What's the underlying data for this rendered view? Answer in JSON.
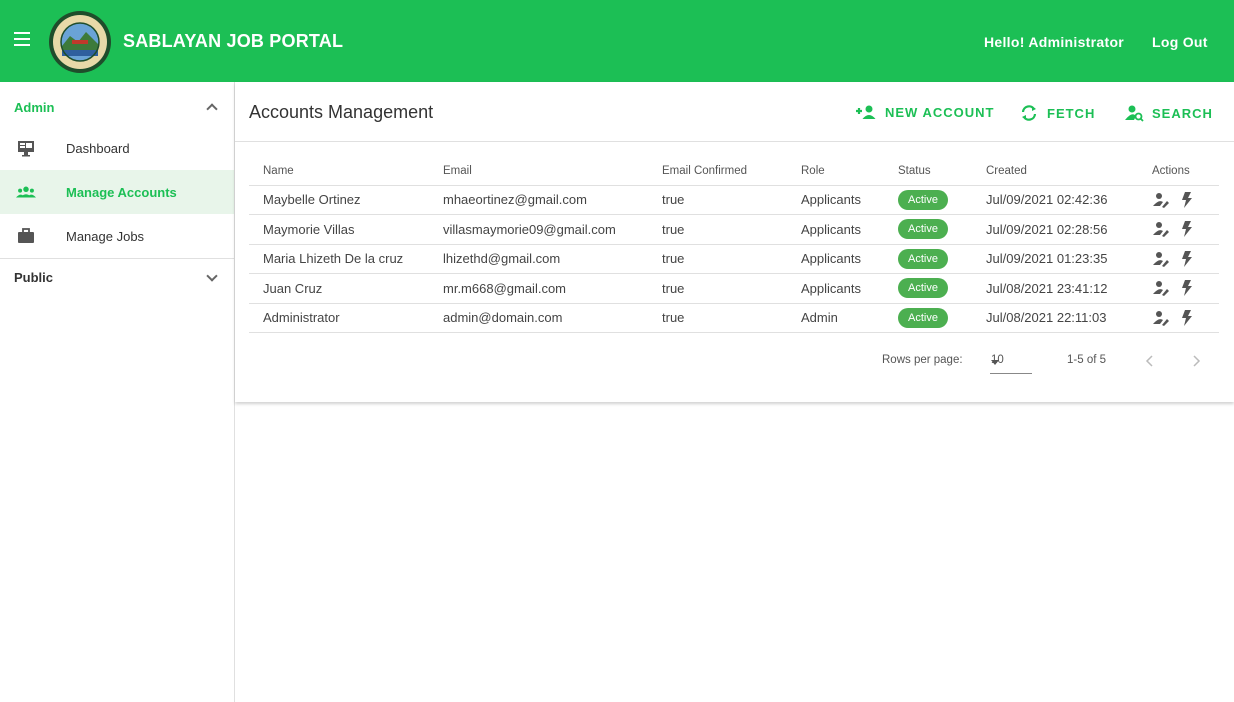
{
  "app": {
    "title": "SABLAYAN JOB PORTAL",
    "greeting": "Hello! Administrator",
    "logout_label": "Log Out"
  },
  "colors": {
    "primary": "#1cbf55",
    "active_badge": "#4caf50",
    "active_nav_bg": "#e8f5ea"
  },
  "sidebar": {
    "groups": [
      {
        "label": "Admin",
        "expanded": true,
        "items": [
          {
            "label": "Dashboard",
            "icon": "monitor-icon"
          },
          {
            "label": "Manage Accounts",
            "icon": "people-icon",
            "active": true
          },
          {
            "label": "Manage Jobs",
            "icon": "briefcase-icon"
          }
        ]
      },
      {
        "label": "Public",
        "expanded": false
      }
    ]
  },
  "main": {
    "title": "Accounts Management",
    "toolbar": {
      "new_account": "NEW ACCOUNT",
      "fetch": "FETCH",
      "search": "SEARCH"
    },
    "table": {
      "columns": [
        "Name",
        "Email",
        "Email Confirmed",
        "Role",
        "Status",
        "Created",
        "Actions"
      ],
      "rows": [
        [
          "Maybelle Ortinez",
          "mhaeortinez@gmail.com",
          "true",
          "Applicants",
          "Active",
          "Jul/09/2021 02:42:36"
        ],
        [
          "Maymorie Villas",
          "villasmaymorie09@gmail.com",
          "true",
          "Applicants",
          "Active",
          "Jul/09/2021 02:28:56"
        ],
        [
          "Maria Lhizeth De la cruz",
          "lhizethd@gmail.com",
          "true",
          "Applicants",
          "Active",
          "Jul/09/2021 01:23:35"
        ],
        [
          "Juan Cruz",
          "mr.m668@gmail.com",
          "true",
          "Applicants",
          "Active",
          "Jul/08/2021 23:41:12"
        ],
        [
          "Administrator",
          "admin@domain.com",
          "true",
          "Admin",
          "Active",
          "Jul/08/2021 22:11:03"
        ]
      ]
    },
    "pager": {
      "rows_per_page_label": "Rows per page:",
      "rows_per_page": "10",
      "range": "1-5 of 5"
    }
  }
}
